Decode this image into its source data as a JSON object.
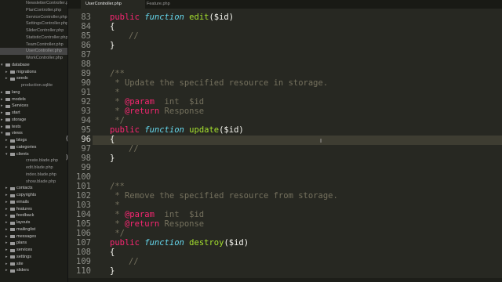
{
  "sidebar": {
    "rows": [
      {
        "label": "NewsletterController.php",
        "type": "file",
        "level": 3,
        "expanded": null
      },
      {
        "label": "PlanController.php",
        "type": "file",
        "level": 3,
        "expanded": null
      },
      {
        "label": "ServiceController.php",
        "type": "file",
        "level": 3,
        "expanded": null
      },
      {
        "label": "SettingsController.php",
        "type": "file",
        "level": 3,
        "expanded": null
      },
      {
        "label": "SliderController.php",
        "type": "file",
        "level": 3,
        "expanded": null
      },
      {
        "label": "StatisticController.php",
        "type": "file",
        "level": 3,
        "expanded": null
      },
      {
        "label": "TeamController.php",
        "type": "file",
        "level": 3,
        "expanded": null
      },
      {
        "label": "UserController.php",
        "type": "file",
        "level": 3,
        "expanded": null,
        "active": true
      },
      {
        "label": "WorkController.php",
        "type": "file",
        "level": 3,
        "expanded": null
      },
      {
        "label": "database",
        "type": "folder",
        "level": 0,
        "expanded": true
      },
      {
        "label": "migrations",
        "type": "folder",
        "level": 1,
        "expanded": false
      },
      {
        "label": "seeds",
        "type": "folder",
        "level": 1,
        "expanded": false
      },
      {
        "label": "production.sqlite",
        "type": "file",
        "level": 2,
        "expanded": null
      },
      {
        "label": "lang",
        "type": "folder",
        "level": 0,
        "expanded": false
      },
      {
        "label": "models",
        "type": "folder",
        "level": 0,
        "expanded": false
      },
      {
        "label": "Services",
        "type": "folder",
        "level": 0,
        "expanded": false
      },
      {
        "label": "start",
        "type": "folder",
        "level": 0,
        "expanded": false
      },
      {
        "label": "storage",
        "type": "folder",
        "level": 0,
        "expanded": false
      },
      {
        "label": "tests",
        "type": "folder",
        "level": 0,
        "expanded": false
      },
      {
        "label": "views",
        "type": "folder",
        "level": 0,
        "expanded": true
      },
      {
        "label": "blogs",
        "type": "folder",
        "level": 1,
        "expanded": false
      },
      {
        "label": "categories",
        "type": "folder",
        "level": 1,
        "expanded": false
      },
      {
        "label": "clients",
        "type": "folder",
        "level": 1,
        "expanded": true
      },
      {
        "label": "create.blade.php",
        "type": "file",
        "level": 3,
        "expanded": null
      },
      {
        "label": "edit.blade.php",
        "type": "file",
        "level": 3,
        "expanded": null
      },
      {
        "label": "index.blade.php",
        "type": "file",
        "level": 3,
        "expanded": null
      },
      {
        "label": "show.blade.php",
        "type": "file",
        "level": 3,
        "expanded": null
      },
      {
        "label": "contacts",
        "type": "folder",
        "level": 1,
        "expanded": false
      },
      {
        "label": "copyrights",
        "type": "folder",
        "level": 1,
        "expanded": false
      },
      {
        "label": "emails",
        "type": "folder",
        "level": 1,
        "expanded": false
      },
      {
        "label": "features",
        "type": "folder",
        "level": 1,
        "expanded": false
      },
      {
        "label": "feedback",
        "type": "folder",
        "level": 1,
        "expanded": false
      },
      {
        "label": "layouts",
        "type": "folder",
        "level": 1,
        "expanded": false
      },
      {
        "label": "mailinglist",
        "type": "folder",
        "level": 1,
        "expanded": false
      },
      {
        "label": "messages",
        "type": "folder",
        "level": 1,
        "expanded": false
      },
      {
        "label": "plans",
        "type": "folder",
        "level": 1,
        "expanded": false
      },
      {
        "label": "services",
        "type": "folder",
        "level": 1,
        "expanded": false
      },
      {
        "label": "settings",
        "type": "folder",
        "level": 1,
        "expanded": false
      },
      {
        "label": "site",
        "type": "folder",
        "level": 1,
        "expanded": false
      },
      {
        "label": "sliders",
        "type": "folder",
        "level": 1,
        "expanded": false
      }
    ]
  },
  "tabs": [
    {
      "label": "UserController.php",
      "active": true
    },
    {
      "label": "Feature.php",
      "active": false
    }
  ],
  "editor": {
    "current_line": 96,
    "fold_markers": {
      "96": "(",
      "98": ")"
    },
    "lines": [
      {
        "n": 83,
        "indent": 0,
        "tokens": [
          [
            "kw",
            "public "
          ],
          [
            "sf",
            "function "
          ],
          [
            "fn",
            "edit"
          ],
          [
            "var",
            "($id)"
          ]
        ]
      },
      {
        "n": 84,
        "indent": 0,
        "tokens": [
          [
            "var",
            "{"
          ]
        ]
      },
      {
        "n": 85,
        "indent": 1,
        "tokens": [
          [
            "cm",
            "//"
          ]
        ]
      },
      {
        "n": 86,
        "indent": 0,
        "tokens": [
          [
            "var",
            "}"
          ]
        ]
      },
      {
        "n": 87,
        "indent": 0,
        "tokens": []
      },
      {
        "n": 88,
        "indent": 0,
        "tokens": []
      },
      {
        "n": 89,
        "indent": 0,
        "tokens": [
          [
            "cm",
            "/**"
          ]
        ]
      },
      {
        "n": 90,
        "indent": 0,
        "tokens": [
          [
            "cm",
            " * Update the specified resource in storage."
          ]
        ]
      },
      {
        "n": 91,
        "indent": 0,
        "tokens": [
          [
            "cm",
            " *"
          ]
        ]
      },
      {
        "n": 92,
        "indent": 0,
        "tokens": [
          [
            "cm",
            " * "
          ],
          [
            "ph",
            "@param"
          ],
          [
            "cm",
            "  int  $id"
          ]
        ]
      },
      {
        "n": 93,
        "indent": 0,
        "tokens": [
          [
            "cm",
            " * "
          ],
          [
            "ph",
            "@return"
          ],
          [
            "cm",
            " Response"
          ]
        ]
      },
      {
        "n": 94,
        "indent": 0,
        "tokens": [
          [
            "cm",
            " */"
          ]
        ]
      },
      {
        "n": 95,
        "indent": 0,
        "tokens": [
          [
            "kw",
            "public "
          ],
          [
            "sf",
            "function "
          ],
          [
            "fn",
            "update"
          ],
          [
            "var",
            "($id)"
          ]
        ]
      },
      {
        "n": 96,
        "indent": 0,
        "tokens": [
          [
            "var",
            "{"
          ]
        ]
      },
      {
        "n": 97,
        "indent": 1,
        "tokens": [
          [
            "cm",
            "//"
          ]
        ]
      },
      {
        "n": 98,
        "indent": 0,
        "tokens": [
          [
            "var",
            "}"
          ]
        ]
      },
      {
        "n": 99,
        "indent": 0,
        "tokens": []
      },
      {
        "n": 100,
        "indent": 0,
        "tokens": []
      },
      {
        "n": 101,
        "indent": 0,
        "tokens": [
          [
            "cm",
            "/**"
          ]
        ]
      },
      {
        "n": 102,
        "indent": 0,
        "tokens": [
          [
            "cm",
            " * Remove the specified resource from storage."
          ]
        ]
      },
      {
        "n": 103,
        "indent": 0,
        "tokens": [
          [
            "cm",
            " *"
          ]
        ]
      },
      {
        "n": 104,
        "indent": 0,
        "tokens": [
          [
            "cm",
            " * "
          ],
          [
            "ph",
            "@param"
          ],
          [
            "cm",
            "  int  $id"
          ]
        ]
      },
      {
        "n": 105,
        "indent": 0,
        "tokens": [
          [
            "cm",
            " * "
          ],
          [
            "ph",
            "@return"
          ],
          [
            "cm",
            " Response"
          ]
        ]
      },
      {
        "n": 106,
        "indent": 0,
        "tokens": [
          [
            "cm",
            " */"
          ]
        ]
      },
      {
        "n": 107,
        "indent": 0,
        "tokens": [
          [
            "kw",
            "public "
          ],
          [
            "sf",
            "function "
          ],
          [
            "fn",
            "destroy"
          ],
          [
            "var",
            "($id)"
          ]
        ]
      },
      {
        "n": 108,
        "indent": 0,
        "tokens": [
          [
            "var",
            "{"
          ]
        ]
      },
      {
        "n": 109,
        "indent": 1,
        "tokens": [
          [
            "cm",
            "//"
          ]
        ]
      },
      {
        "n": 110,
        "indent": 0,
        "tokens": [
          [
            "var",
            "}"
          ]
        ]
      }
    ]
  },
  "colors": {
    "background": "#272822",
    "sidebar_bg": "#1d1e19",
    "keyword": "#f92672",
    "storage": "#66d9ef",
    "function_name": "#a6e22e",
    "comment": "#75715e",
    "text": "#f8f8f2",
    "line_number": "#8f908a",
    "current_line": "#3e3d32"
  },
  "icons": {
    "folder": "folder-icon",
    "disclosure": "disclosure-triangle-icon",
    "text_cursor": "i-beam-cursor-icon"
  }
}
